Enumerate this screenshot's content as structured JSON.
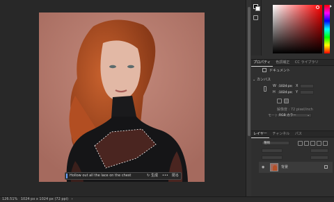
{
  "statusbar": {
    "zoom": "126.51%",
    "doc_info": "1024 px x 1024 px (72 ppi)"
  },
  "properties": {
    "tabs": [
      "プロパティ",
      "色調補正",
      "CC ライブラリ"
    ],
    "section_document": "ドキュメント",
    "section_canvas": "カンバス",
    "width_label": "W",
    "width_value": "1024 px",
    "height_label": "H",
    "height_value": "1024 px",
    "x_label": "X",
    "y_label": "Y",
    "resolution": "解像度 : 72 pixel/inch",
    "mode_label": "モード",
    "mode_value": "RGB カラー"
  },
  "layers": {
    "tabs": [
      "レイヤー",
      "チャンネル",
      "パス"
    ],
    "filter_placeholder": "種類",
    "layer_name": "背景"
  },
  "prompt": {
    "text": "Hollow out all the lace on the chest",
    "generate_label": "生成",
    "more": "•••",
    "close_label": "閉る"
  },
  "colors": {
    "accent": "#6aa0ff",
    "panel_bg": "#2f2f2f",
    "canvas_bg": "#282828"
  }
}
